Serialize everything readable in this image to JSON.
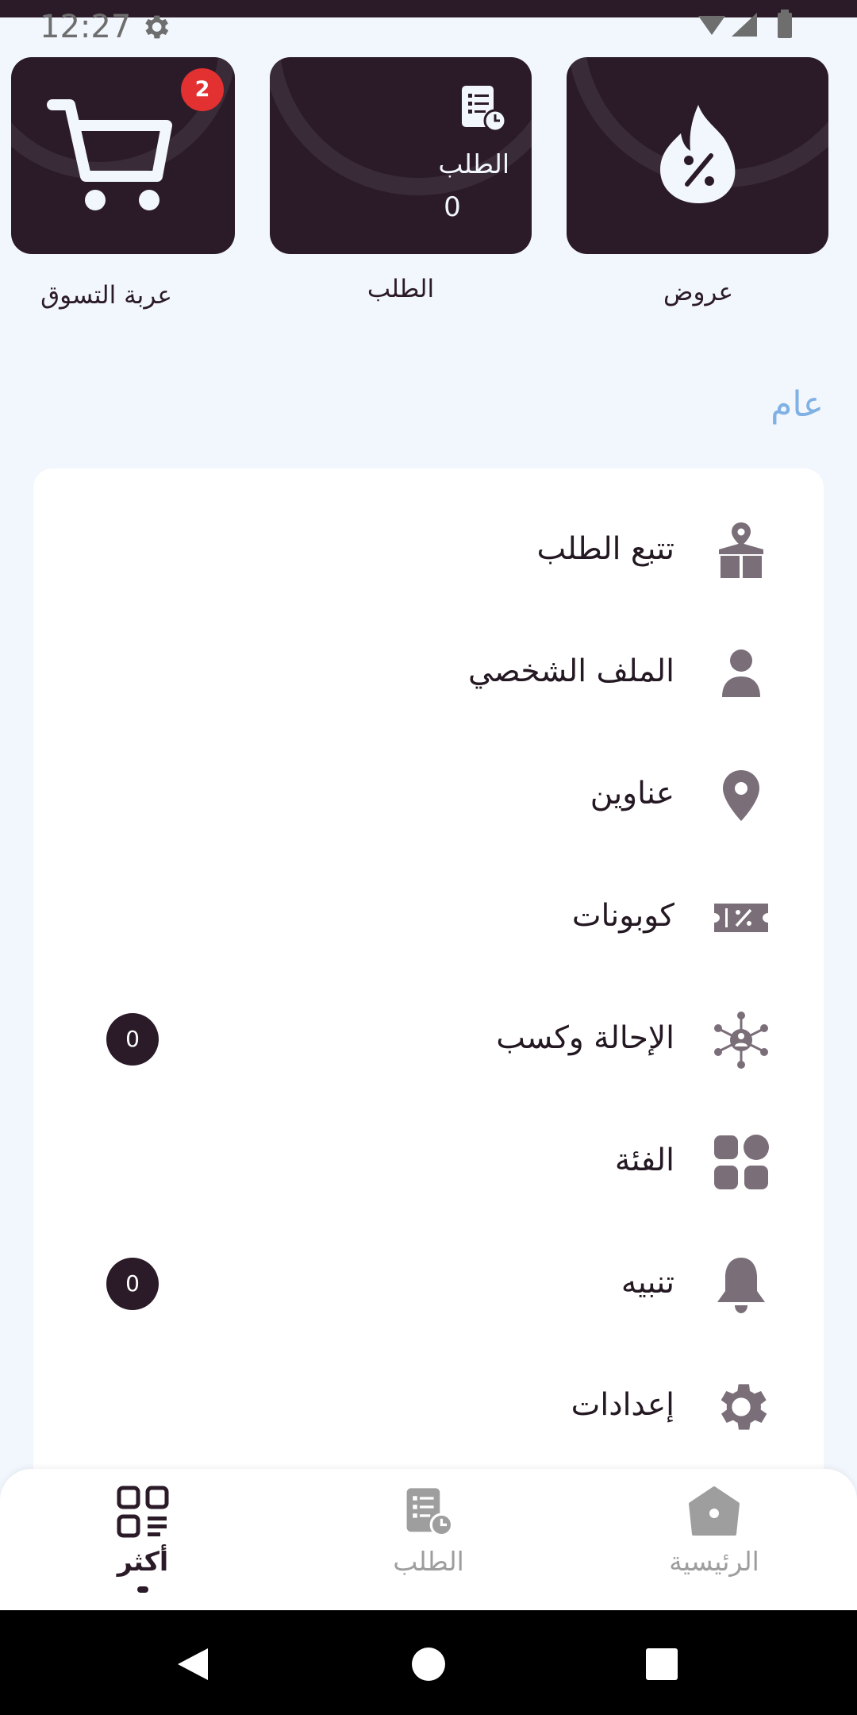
{
  "status_bar": {
    "time": "12:27"
  },
  "top_cards": {
    "cart": {
      "label": "عربة التسوق",
      "badge_count": "2"
    },
    "order": {
      "card_title": "الطلب",
      "card_count": "0",
      "label": "الطلب"
    },
    "offers": {
      "label": "عروض"
    }
  },
  "section": {
    "title": "عام"
  },
  "menu": {
    "items": [
      {
        "label": "تتبع الطلب",
        "icon": "package-location-icon"
      },
      {
        "label": "الملف الشخصي",
        "icon": "user-icon"
      },
      {
        "label": "عناوين",
        "icon": "map-pin-icon"
      },
      {
        "label": "كوبونات",
        "icon": "coupon-icon"
      },
      {
        "label": "الإحالة وكسب",
        "icon": "referral-network-icon",
        "count": "0"
      },
      {
        "label": "الفئة",
        "icon": "category-grid-icon"
      },
      {
        "label": "تنبيه",
        "icon": "bell-icon",
        "count": "0"
      },
      {
        "label": "إعدادات",
        "icon": "gear-icon"
      }
    ]
  },
  "bottom_nav": {
    "more": {
      "label": "أكثر",
      "active": true
    },
    "order": {
      "label": "الطلب"
    },
    "home": {
      "label": "الرئيسية"
    }
  },
  "colors": {
    "primary": "#2b1b28",
    "background": "#f2f6fd",
    "accent_blue": "#7fb1e4",
    "badge_red": "#e33030",
    "icon_gray": "#7a6e78",
    "nav_inactive": "#9e9e9e"
  }
}
